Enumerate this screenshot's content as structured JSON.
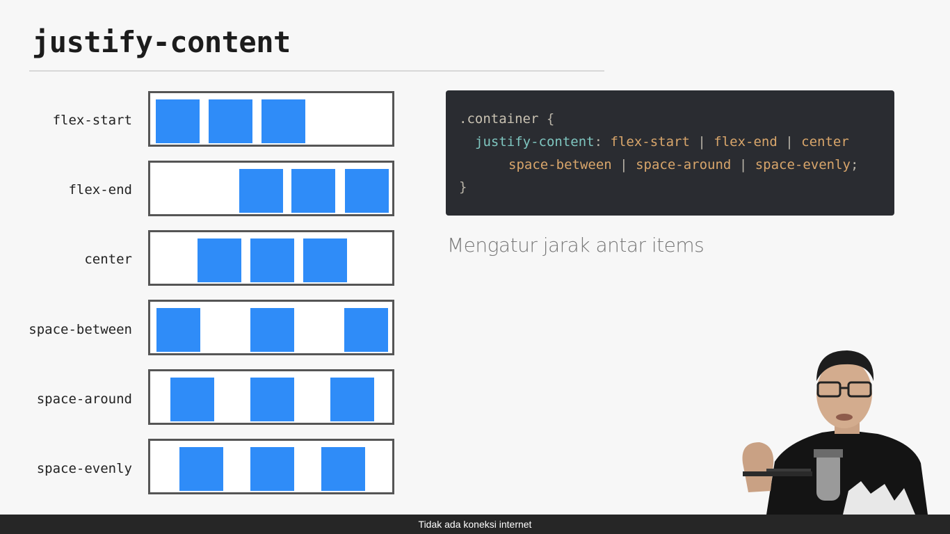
{
  "slide": {
    "title": "justify-content",
    "description": "Mengatur jarak antar items"
  },
  "demos": [
    {
      "label": "flex-start"
    },
    {
      "label": "flex-end"
    },
    {
      "label": "center"
    },
    {
      "label": "space-between"
    },
    {
      "label": "space-around"
    },
    {
      "label": "space-evenly"
    }
  ],
  "code": {
    "selector": ".container",
    "open_brace": "{",
    "property": "justify-content",
    "colon": ":",
    "values": [
      "flex-start",
      "flex-end",
      "center",
      "space-between",
      "space-around",
      "space-evenly"
    ],
    "separator": "|",
    "semicolon": ";",
    "close_brace": "}"
  },
  "status": {
    "message": "Tidak ada koneksi internet"
  },
  "colors": {
    "item": "#2f8cf8",
    "code_background": "#2a2c31",
    "code_property": "#7fc6c0",
    "code_value": "#d9a66b"
  }
}
